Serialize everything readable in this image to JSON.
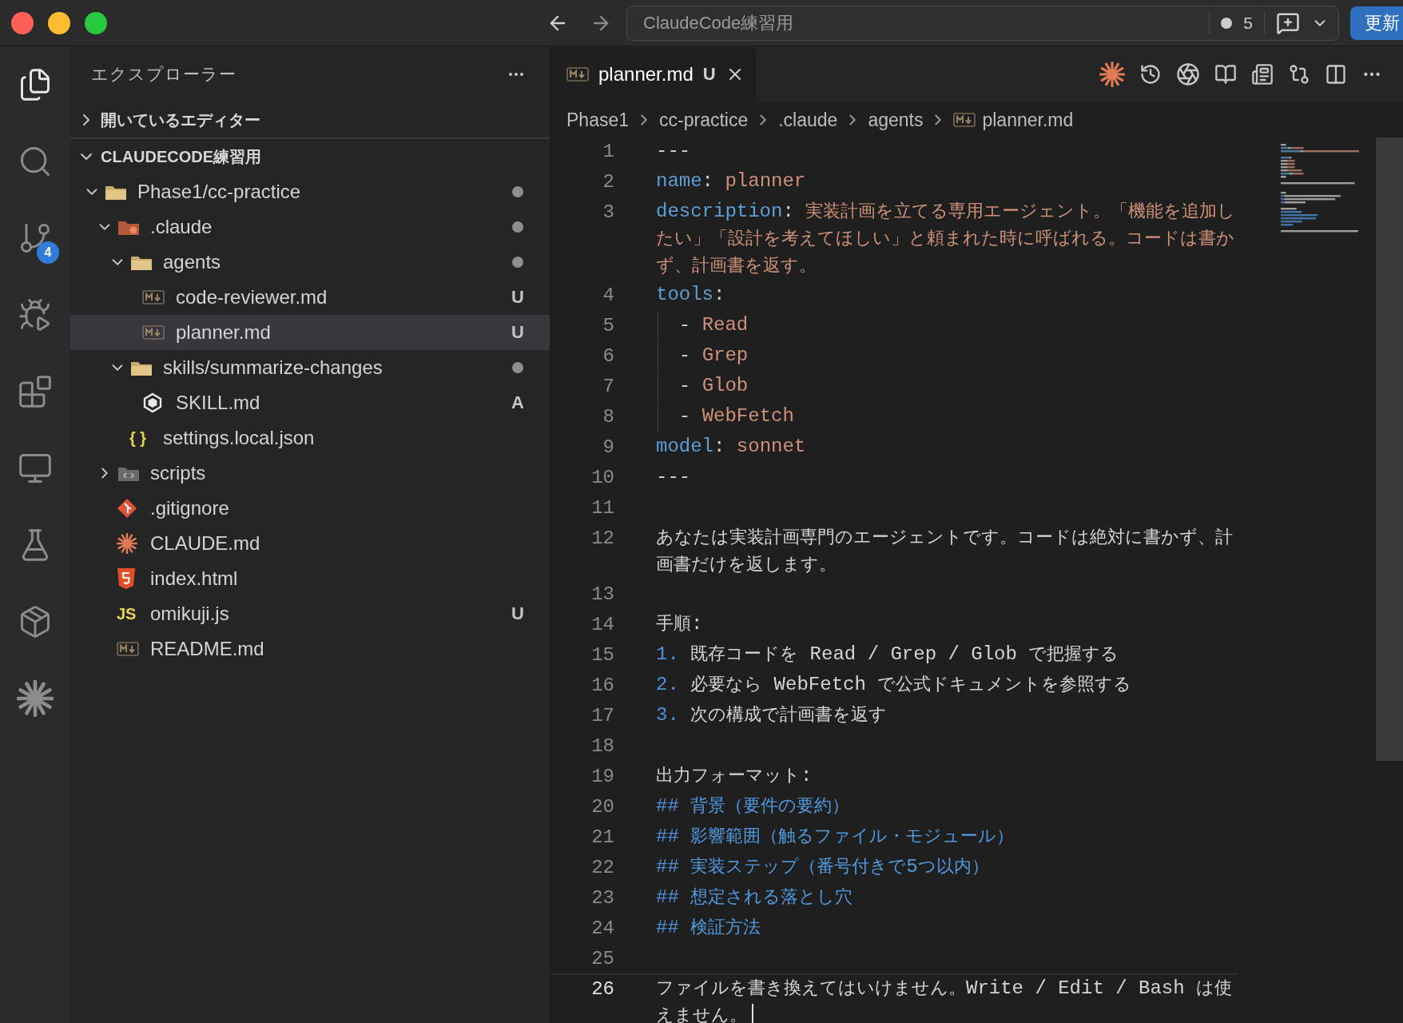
{
  "window": {
    "title": "ClaudeCode練習用",
    "count": "5",
    "update_button": "更新"
  },
  "activity_bar": [
    {
      "kind": "files",
      "selected": true
    },
    {
      "kind": "search",
      "selected": false
    },
    {
      "kind": "source-control",
      "selected": false,
      "badge": "4"
    },
    {
      "kind": "run-debug",
      "selected": false
    },
    {
      "kind": "extensions",
      "selected": false
    },
    {
      "kind": "remote",
      "selected": false
    },
    {
      "kind": "testing",
      "selected": false
    },
    {
      "kind": "containers",
      "selected": false
    },
    {
      "kind": "claude",
      "selected": false
    }
  ],
  "sidebar": {
    "title": "エクスプローラー",
    "sections": [
      {
        "label": "開いているエディター",
        "expanded": false
      },
      {
        "label": "CLAUDECODE練習用",
        "expanded": true,
        "tree": [
          {
            "label": "Phase1/cc-practice",
            "kind": "folder",
            "expanded": true,
            "dot": true,
            "selected": false,
            "children": [
              {
                "label": ".claude",
                "kind": "claude-folder",
                "expanded": true,
                "dot": true,
                "selected": false,
                "children": [
                  {
                    "label": "agents",
                    "kind": "folder",
                    "expanded": true,
                    "dot": true,
                    "selected": false,
                    "children": [
                      {
                        "label": "code-reviewer.md",
                        "kind": "markdown",
                        "dot": false,
                        "selected": false,
                        "decoration": "U"
                      },
                      {
                        "label": "planner.md",
                        "kind": "markdown",
                        "dot": false,
                        "selected": true,
                        "decoration": "U"
                      }
                    ]
                  },
                  {
                    "label": "skills/summarize-changes",
                    "kind": "folder",
                    "expanded": true,
                    "dot": true,
                    "selected": false,
                    "children": [
                      {
                        "label": "SKILL.md",
                        "kind": "skill",
                        "dot": false,
                        "selected": false,
                        "decoration": "A"
                      }
                    ]
                  },
                  {
                    "label": "settings.local.json",
                    "kind": "json",
                    "icon_text": "{ }",
                    "dot": false,
                    "selected": false
                  }
                ]
              },
              {
                "label": "scripts",
                "kind": "scripts-folder",
                "expanded": false,
                "dot": false,
                "selected": false
              },
              {
                "label": ".gitignore",
                "kind": "git",
                "dot": false,
                "selected": false
              },
              {
                "label": "CLAUDE.md",
                "kind": "claude",
                "dot": false,
                "selected": false
              },
              {
                "label": "index.html",
                "kind": "html",
                "dot": false,
                "selected": false
              },
              {
                "label": "omikuji.js",
                "kind": "js",
                "icon_text": "JS",
                "dot": false,
                "selected": false,
                "decoration": "U"
              },
              {
                "label": "README.md",
                "kind": "markdown",
                "dot": false,
                "selected": false
              }
            ]
          }
        ]
      }
    ]
  },
  "editor": {
    "tabs": [
      {
        "label": "planner.md",
        "kind": "markdown",
        "status": "U",
        "selected": true
      }
    ],
    "breadcrumb": [
      {
        "label": "Phase1",
        "kind": "folder"
      },
      {
        "label": "cc-practice",
        "kind": "folder"
      },
      {
        "label": ".claude",
        "kind": "folder"
      },
      {
        "label": "agents",
        "kind": "folder"
      },
      {
        "label": "planner.md",
        "kind": "markdown"
      }
    ],
    "lines": [
      {
        "number": "1",
        "current": false,
        "tokens": [
          {
            "kind": "plain",
            "text": "---"
          }
        ]
      },
      {
        "number": "2",
        "current": false,
        "tokens": [
          {
            "kind": "key",
            "text": "name"
          },
          {
            "kind": "plain",
            "text": ": "
          },
          {
            "kind": "value",
            "text": "planner"
          }
        ]
      },
      {
        "number": "3",
        "current": false,
        "tokens": [
          {
            "kind": "key",
            "text": "description"
          },
          {
            "kind": "plain",
            "text": ": "
          },
          {
            "kind": "value",
            "text": "実装計画を立てる専用エージェント。「機能を追加したい」「設計を考えてほしい」と頼まれた時に呼ばれる。コードは書かず、計画書を返す。"
          }
        ]
      },
      {
        "number": "4",
        "current": false,
        "tokens": [
          {
            "kind": "key",
            "text": "tools"
          },
          {
            "kind": "plain",
            "text": ":"
          }
        ]
      },
      {
        "number": "5",
        "current": false,
        "guide": true,
        "tokens": [
          {
            "kind": "plain",
            "text": "  - "
          },
          {
            "kind": "value",
            "text": "Read"
          }
        ]
      },
      {
        "number": "6",
        "current": false,
        "guide": true,
        "tokens": [
          {
            "kind": "plain",
            "text": "  - "
          },
          {
            "kind": "value",
            "text": "Grep"
          }
        ]
      },
      {
        "number": "7",
        "current": false,
        "guide": true,
        "tokens": [
          {
            "kind": "plain",
            "text": "  - "
          },
          {
            "kind": "value",
            "text": "Glob"
          }
        ]
      },
      {
        "number": "8",
        "current": false,
        "guide": true,
        "tokens": [
          {
            "kind": "plain",
            "text": "  - "
          },
          {
            "kind": "value",
            "text": "WebFetch"
          }
        ]
      },
      {
        "number": "9",
        "current": false,
        "tokens": [
          {
            "kind": "key",
            "text": "model"
          },
          {
            "kind": "plain",
            "text": ": "
          },
          {
            "kind": "value",
            "text": "sonnet"
          }
        ]
      },
      {
        "number": "10",
        "current": false,
        "tokens": [
          {
            "kind": "plain",
            "text": "---"
          }
        ]
      },
      {
        "number": "11",
        "current": false
      },
      {
        "number": "12",
        "current": false,
        "tokens": [
          {
            "kind": "plain",
            "text": "あなたは実装計画専門のエージェントです。コードは絶対に書かず、計画書だけを返します。"
          }
        ]
      },
      {
        "number": "13",
        "current": false
      },
      {
        "number": "14",
        "current": false,
        "tokens": [
          {
            "kind": "plain",
            "text": "手順:"
          }
        ]
      },
      {
        "number": "15",
        "current": false,
        "tokens": [
          {
            "kind": "marker",
            "text": "1."
          },
          {
            "kind": "plain",
            "text": " 既存コードを Read / Grep / Glob で把握する"
          }
        ]
      },
      {
        "number": "16",
        "current": false,
        "tokens": [
          {
            "kind": "marker",
            "text": "2."
          },
          {
            "kind": "plain",
            "text": " 必要なら WebFetch で公式ドキュメントを参照する"
          }
        ]
      },
      {
        "number": "17",
        "current": false,
        "tokens": [
          {
            "kind": "marker",
            "text": "3."
          },
          {
            "kind": "plain",
            "text": " 次の構成で計画書を返す"
          }
        ]
      },
      {
        "number": "18",
        "current": false
      },
      {
        "number": "19",
        "current": false,
        "tokens": [
          {
            "kind": "plain",
            "text": "出力フォーマット:"
          }
        ]
      },
      {
        "number": "20",
        "current": false,
        "tokens": [
          {
            "kind": "marker",
            "text": "##"
          },
          {
            "kind": "heading",
            "text": " 背景（要件の要約）"
          }
        ]
      },
      {
        "number": "21",
        "current": false,
        "tokens": [
          {
            "kind": "marker",
            "text": "##"
          },
          {
            "kind": "heading",
            "text": " 影響範囲（触るファイル・モジュール）"
          }
        ]
      },
      {
        "number": "22",
        "current": false,
        "tokens": [
          {
            "kind": "marker",
            "text": "##"
          },
          {
            "kind": "heading",
            "text": " 実装ステップ（番号付きで5つ以内）"
          }
        ]
      },
      {
        "number": "23",
        "current": false,
        "tokens": [
          {
            "kind": "marker",
            "text": "##"
          },
          {
            "kind": "heading",
            "text": " 想定される落とし穴"
          }
        ]
      },
      {
        "number": "24",
        "current": false,
        "tokens": [
          {
            "kind": "marker",
            "text": "##"
          },
          {
            "kind": "heading",
            "text": " 検証方法"
          }
        ]
      },
      {
        "number": "25",
        "current": false
      },
      {
        "number": "26",
        "current": true,
        "tokens": [
          {
            "kind": "plain",
            "text": "ファイルを書き換えてはいけません。Write / Edit / Bash は使えません。"
          }
        ]
      }
    ]
  }
}
